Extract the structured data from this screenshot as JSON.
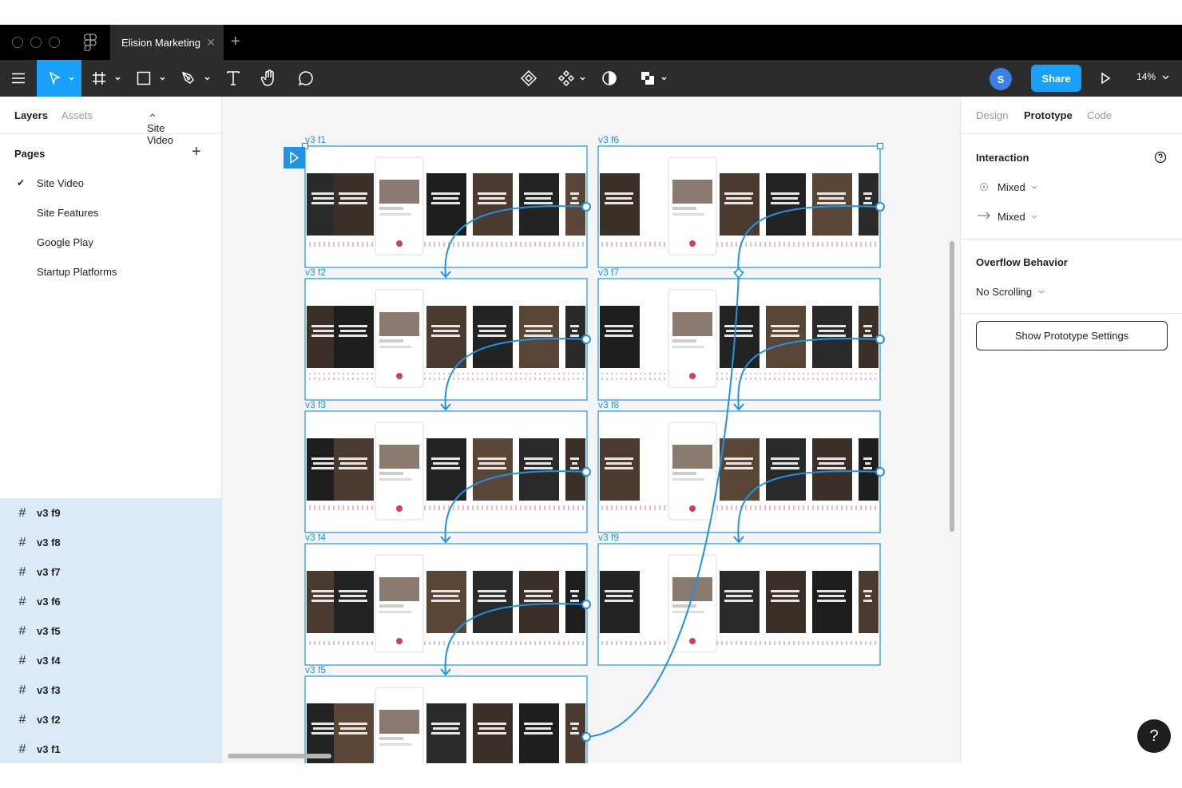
{
  "window": {
    "file_tab": "Elision Marketing"
  },
  "toolbar": {
    "avatar_initial": "S",
    "share_label": "Share",
    "zoom": "14%"
  },
  "left_panel": {
    "tab_layers": "Layers",
    "tab_assets": "Assets",
    "page_selector": "Site Video",
    "pages_heading": "Pages",
    "pages": [
      "Site Video",
      "Site Features",
      "Google Play",
      "Startup Platforms"
    ],
    "layers": [
      "v3 f9",
      "v3 f8",
      "v3 f7",
      "v3 f6",
      "v3 f5",
      "v3 f4",
      "v3 f3",
      "v3 f2",
      "v3 f1"
    ]
  },
  "right_panel": {
    "tab_design": "Design",
    "tab_prototype": "Prototype",
    "tab_code": "Code",
    "interaction_heading": "Interaction",
    "trigger_value": "Mixed",
    "action_value": "Mixed",
    "overflow_heading": "Overflow Behavior",
    "overflow_value": "No Scrolling",
    "prototype_button": "Show Prototype Settings"
  },
  "canvas": {
    "frames": [
      "v3 f1",
      "v3 f2",
      "v3 f3",
      "v3 f4",
      "v3 f5",
      "v3 f6",
      "v3 f7",
      "v3 f8",
      "v3 f9"
    ]
  },
  "colors": {
    "accent": "#18a0fb",
    "toolbar": "#2c2c2c",
    "selection": "#daeaf7",
    "link": "#1f93e6"
  }
}
